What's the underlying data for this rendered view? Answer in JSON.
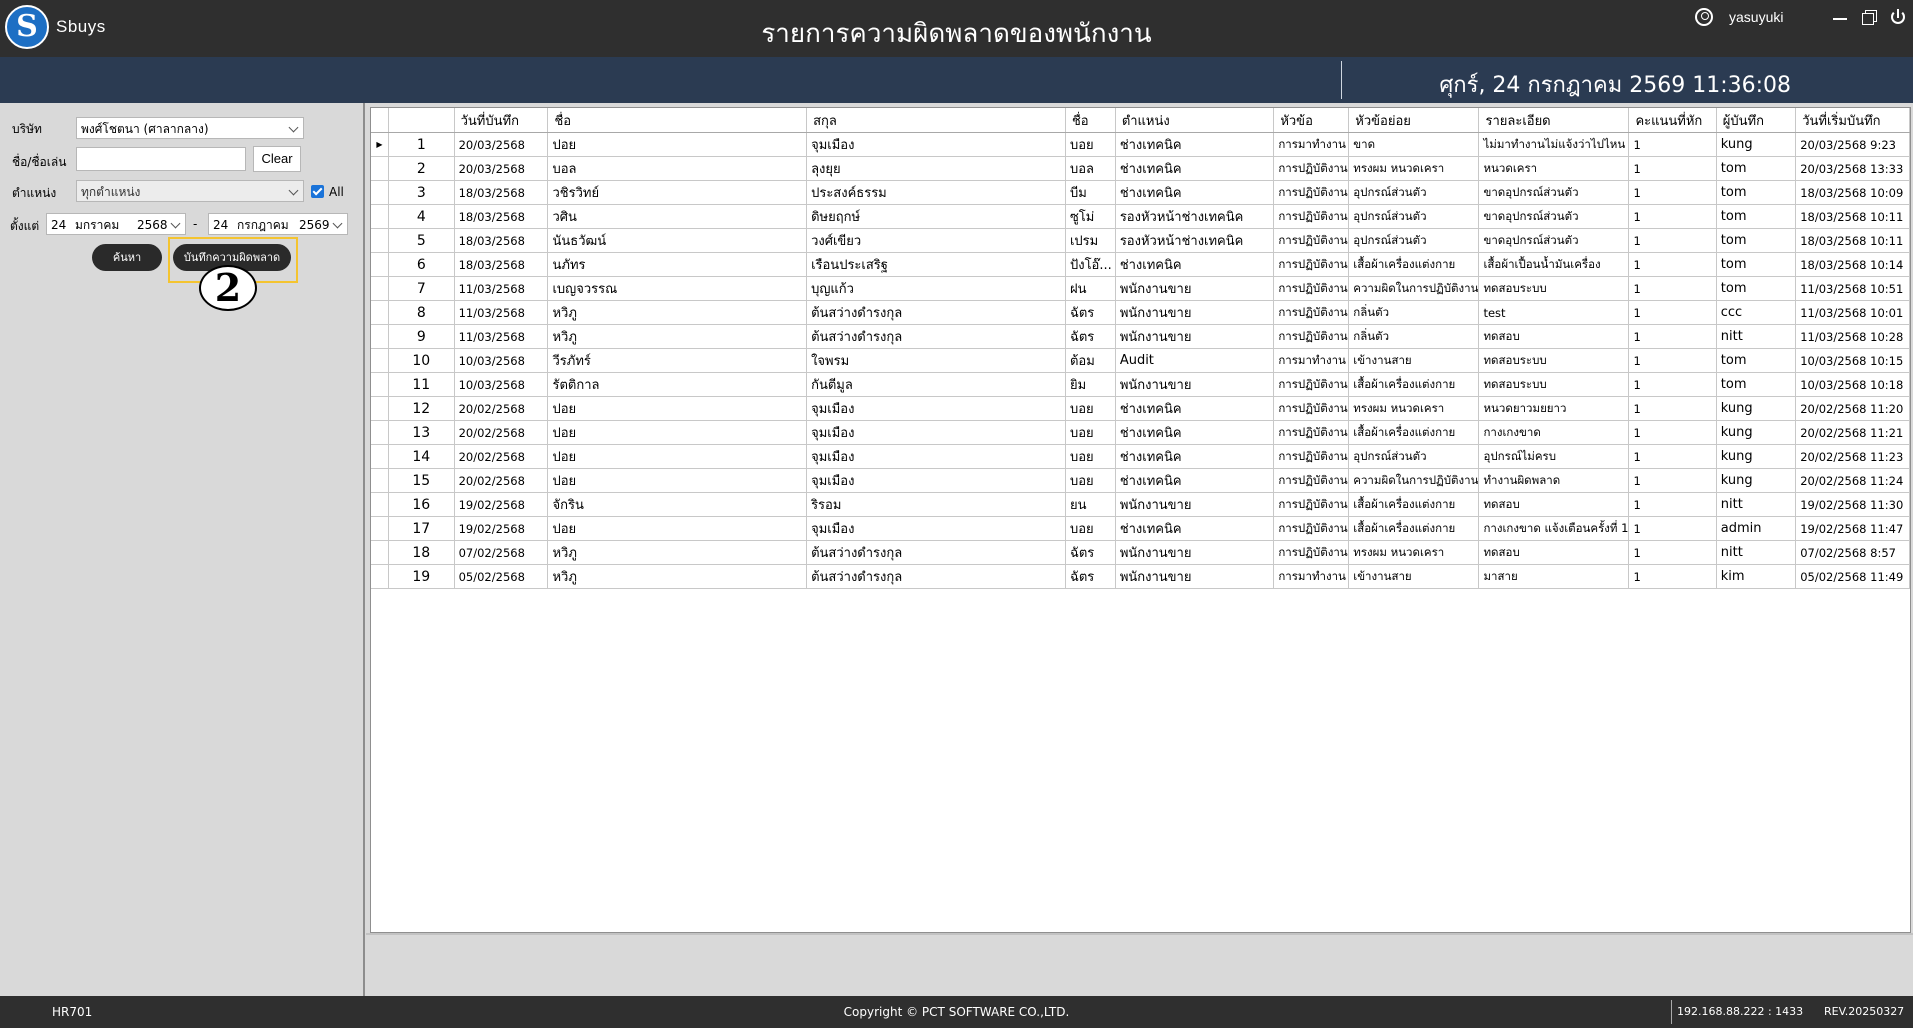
{
  "app": {
    "logo_text": "Sbuys",
    "title": "รายการความผิดพลาดของพนักงาน",
    "user": "yasuyuki",
    "datetime": "ศุกร์, 24 กรกฎาคม 2569 11:36:08"
  },
  "filters": {
    "company_label": "บริษัท",
    "company_value": "พงศ์โชตนา (ศาลากลาง)",
    "name_label": "ชื่อ/ชื่อเล่น",
    "name_value": "",
    "clear_label": "Clear",
    "position_label": "ตำแหน่ง",
    "position_value": "ทุกตำแหน่ง",
    "all_label": "All",
    "all_checked": true,
    "from_label": "ตั้งแต่",
    "date_from": {
      "day": "24",
      "month": "มกราคม",
      "year": "2568"
    },
    "date_sep": "-",
    "date_to": {
      "day": "24",
      "month": "กรกฎาคม",
      "year": "2569"
    },
    "search_label": "ค้นหา",
    "record_label": "บันทึกความผิดพลาด",
    "step_badge": "2"
  },
  "grid": {
    "columns": [
      "",
      "",
      "วันที่บันทึก",
      "ชื่อ",
      "สกุล",
      "ชื่อ",
      "ตำแหน่ง",
      "หัวข้อ",
      "หัวข้อย่อย",
      "รายละเอียด",
      "คะแนนที่หัก",
      "ผู้บันทึก",
      "วันที่เริ่มบันทึก"
    ],
    "rows": [
      {
        "no": "1",
        "date": "20/03/2568",
        "first": "ปอย",
        "last": "จุมเมือง",
        "nick": "บอย",
        "position": "ช่างเทคนิค",
        "topic": "การมาทำงาน",
        "subtopic": "ขาด",
        "detail": "ไม่มาทำงานไม่แจ้งว่าไปไหน",
        "points": "1",
        "recorder": "kung",
        "created": "20/03/2568 9:23"
      },
      {
        "no": "2",
        "date": "20/03/2568",
        "first": "บอล",
        "last": "ลุงยุย",
        "nick": "บอล",
        "position": "ช่างเทคนิค",
        "topic": "การปฏิบัติงาน",
        "subtopic": "ทรงผม หนวดเครา",
        "detail": "หนวดเครา",
        "points": "1",
        "recorder": "tom",
        "created": "20/03/2568 13:33"
      },
      {
        "no": "3",
        "date": "18/03/2568",
        "first": "วชิรวิทย์",
        "last": "ประสงค์ธรรม",
        "nick": "บีม",
        "position": "ช่างเทคนิค",
        "topic": "การปฏิบัติงาน",
        "subtopic": "อุปกรณ์ส่วนตัว",
        "detail": "ขาดอุปกรณ์ส่วนตัว",
        "points": "1",
        "recorder": "tom",
        "created": "18/03/2568 10:09"
      },
      {
        "no": "4",
        "date": "18/03/2568",
        "first": "วศิน",
        "last": "ดิษยฤกษ์",
        "nick": "ซูโม่",
        "position": "รองหัวหน้าช่างเทคนิค",
        "topic": "การปฏิบัติงาน",
        "subtopic": "อุปกรณ์ส่วนตัว",
        "detail": "ขาดอุปกรณ์ส่วนตัว",
        "points": "1",
        "recorder": "tom",
        "created": "18/03/2568 10:11"
      },
      {
        "no": "5",
        "date": "18/03/2568",
        "first": "นันธวัฒน์",
        "last": "วงศ์เขียว",
        "nick": "เปรม",
        "position": "รองหัวหน้าช่างเทคนิค",
        "topic": "การปฏิบัติงาน",
        "subtopic": "อุปกรณ์ส่วนตัว",
        "detail": "ขาดอุปกรณ์ส่วนตัว",
        "points": "1",
        "recorder": "tom",
        "created": "18/03/2568 10:11"
      },
      {
        "no": "6",
        "date": "18/03/2568",
        "first": "นภัทร",
        "last": "เรือนประเสริฐ",
        "nick": "ปังโอ๊...",
        "position": "ช่างเทคนิค",
        "topic": "การปฏิบัติงาน",
        "subtopic": "เสื้อผ้าเครื่องแต่งกาย",
        "detail": "เสื้อผ้าเปื้อนน้ำมันเครื่อง",
        "points": "1",
        "recorder": "tom",
        "created": "18/03/2568 10:14"
      },
      {
        "no": "7",
        "date": "11/03/2568",
        "first": "เบญจวรรณ",
        "last": "บุญแก้ว",
        "nick": "ฝน",
        "position": "พนักงานขาย",
        "topic": "การปฏิบัติงาน",
        "subtopic": "ความผิดในการปฏิบัติงาน",
        "detail": "ทดสอบระบบ",
        "points": "1",
        "recorder": "tom",
        "created": "11/03/2568 10:51"
      },
      {
        "no": "8",
        "date": "11/03/2568",
        "first": "หวิภู",
        "last": "ต้นสว่างดำรงกุล",
        "nick": "ฉัตร",
        "position": "พนักงานขาย",
        "topic": "การปฏิบัติงาน",
        "subtopic": "กลิ่นตัว",
        "detail": "test",
        "points": "1",
        "recorder": "ccc",
        "created": "11/03/2568 10:01"
      },
      {
        "no": "9",
        "date": "11/03/2568",
        "first": "หวิภู",
        "last": "ต้นสว่างดำรงกุล",
        "nick": "ฉัตร",
        "position": "พนักงานขาย",
        "topic": "การปฏิบัติงาน",
        "subtopic": "กลิ่นตัว",
        "detail": "ทดสอบ",
        "points": "1",
        "recorder": "nitt",
        "created": "11/03/2568 10:28"
      },
      {
        "no": "10",
        "date": "10/03/2568",
        "first": "วีรภัทร์",
        "last": "ใจพรม",
        "nick": "ต้อม",
        "position": "Audit",
        "topic": "การมาทำงาน",
        "subtopic": "เข้างานสาย",
        "detail": "ทดสอบระบบ",
        "points": "1",
        "recorder": "tom",
        "created": "10/03/2568 10:15"
      },
      {
        "no": "11",
        "date": "10/03/2568",
        "first": "รัตติกาล",
        "last": "กันตีมูล",
        "nick": "ยิม",
        "position": "พนักงานขาย",
        "topic": "การปฏิบัติงาน",
        "subtopic": "เสื้อผ้าเครื่องแต่งกาย",
        "detail": "ทดสอบระบบ",
        "points": "1",
        "recorder": "tom",
        "created": "10/03/2568 10:18"
      },
      {
        "no": "12",
        "date": "20/02/2568",
        "first": "ปอย",
        "last": "จุมเมือง",
        "nick": "บอย",
        "position": "ช่างเทคนิค",
        "topic": "การปฏิบัติงาน",
        "subtopic": "ทรงผม หนวดเครา",
        "detail": "หนวดยาวมยยาว",
        "points": "1",
        "recorder": "kung",
        "created": "20/02/2568 11:20"
      },
      {
        "no": "13",
        "date": "20/02/2568",
        "first": "ปอย",
        "last": "จุมเมือง",
        "nick": "บอย",
        "position": "ช่างเทคนิค",
        "topic": "การปฏิบัติงาน",
        "subtopic": "เสื้อผ้าเครื่องแต่งกาย",
        "detail": "กางเกงขาด",
        "points": "1",
        "recorder": "kung",
        "created": "20/02/2568 11:21"
      },
      {
        "no": "14",
        "date": "20/02/2568",
        "first": "ปอย",
        "last": "จุมเมือง",
        "nick": "บอย",
        "position": "ช่างเทคนิค",
        "topic": "การปฏิบัติงาน",
        "subtopic": "อุปกรณ์ส่วนตัว",
        "detail": "อุปกรณ์ไม่ครบ",
        "points": "1",
        "recorder": "kung",
        "created": "20/02/2568 11:23"
      },
      {
        "no": "15",
        "date": "20/02/2568",
        "first": "ปอย",
        "last": "จุมเมือง",
        "nick": "บอย",
        "position": "ช่างเทคนิค",
        "topic": "การปฏิบัติงาน",
        "subtopic": "ความผิดในการปฏิบัติงาน",
        "detail": "ทำงานผิดพลาด",
        "points": "1",
        "recorder": "kung",
        "created": "20/02/2568 11:24"
      },
      {
        "no": "16",
        "date": "19/02/2568",
        "first": "จักริน",
        "last": "ริรอม",
        "nick": "ยน",
        "position": "พนักงานขาย",
        "topic": "การปฏิบัติงาน",
        "subtopic": "เสื้อผ้าเครื่องแต่งกาย",
        "detail": "ทดสอบ",
        "points": "1",
        "recorder": "nitt",
        "created": "19/02/2568 11:30"
      },
      {
        "no": "17",
        "date": "19/02/2568",
        "first": "ปอย",
        "last": "จุมเมือง",
        "nick": "บอย",
        "position": "ช่างเทคนิค",
        "topic": "การปฏิบัติงาน",
        "subtopic": "เสื้อผ้าเครื่องแต่งกาย",
        "detail": "กางเกงขาด แจ้งเตือนครั้งที่ 1",
        "points": "1",
        "recorder": "admin",
        "created": "19/02/2568 11:47"
      },
      {
        "no": "18",
        "date": "07/02/2568",
        "first": "หวิภู",
        "last": "ต้นสว่างดำรงกุล",
        "nick": "ฉัตร",
        "position": "พนักงานขาย",
        "topic": "การปฏิบัติงาน",
        "subtopic": "ทรงผม หนวดเครา",
        "detail": "ทดสอบ",
        "points": "1",
        "recorder": "nitt",
        "created": "07/02/2568 8:57"
      },
      {
        "no": "19",
        "date": "05/02/2568",
        "first": "หวิภู",
        "last": "ต้นสว่างดำรงกุล",
        "nick": "ฉัตร",
        "position": "พนักงานขาย",
        "topic": "การมาทำงาน",
        "subtopic": "เข้างานสาย",
        "detail": "มาสาย",
        "points": "1",
        "recorder": "kim",
        "created": "05/02/2568 11:49"
      }
    ]
  },
  "status": {
    "code": "HR701",
    "copyright": "Copyright © PCT SOFTWARE CO.,LTD.",
    "server": "192.168.88.222 : 1433",
    "revision": "REV.20250327"
  }
}
